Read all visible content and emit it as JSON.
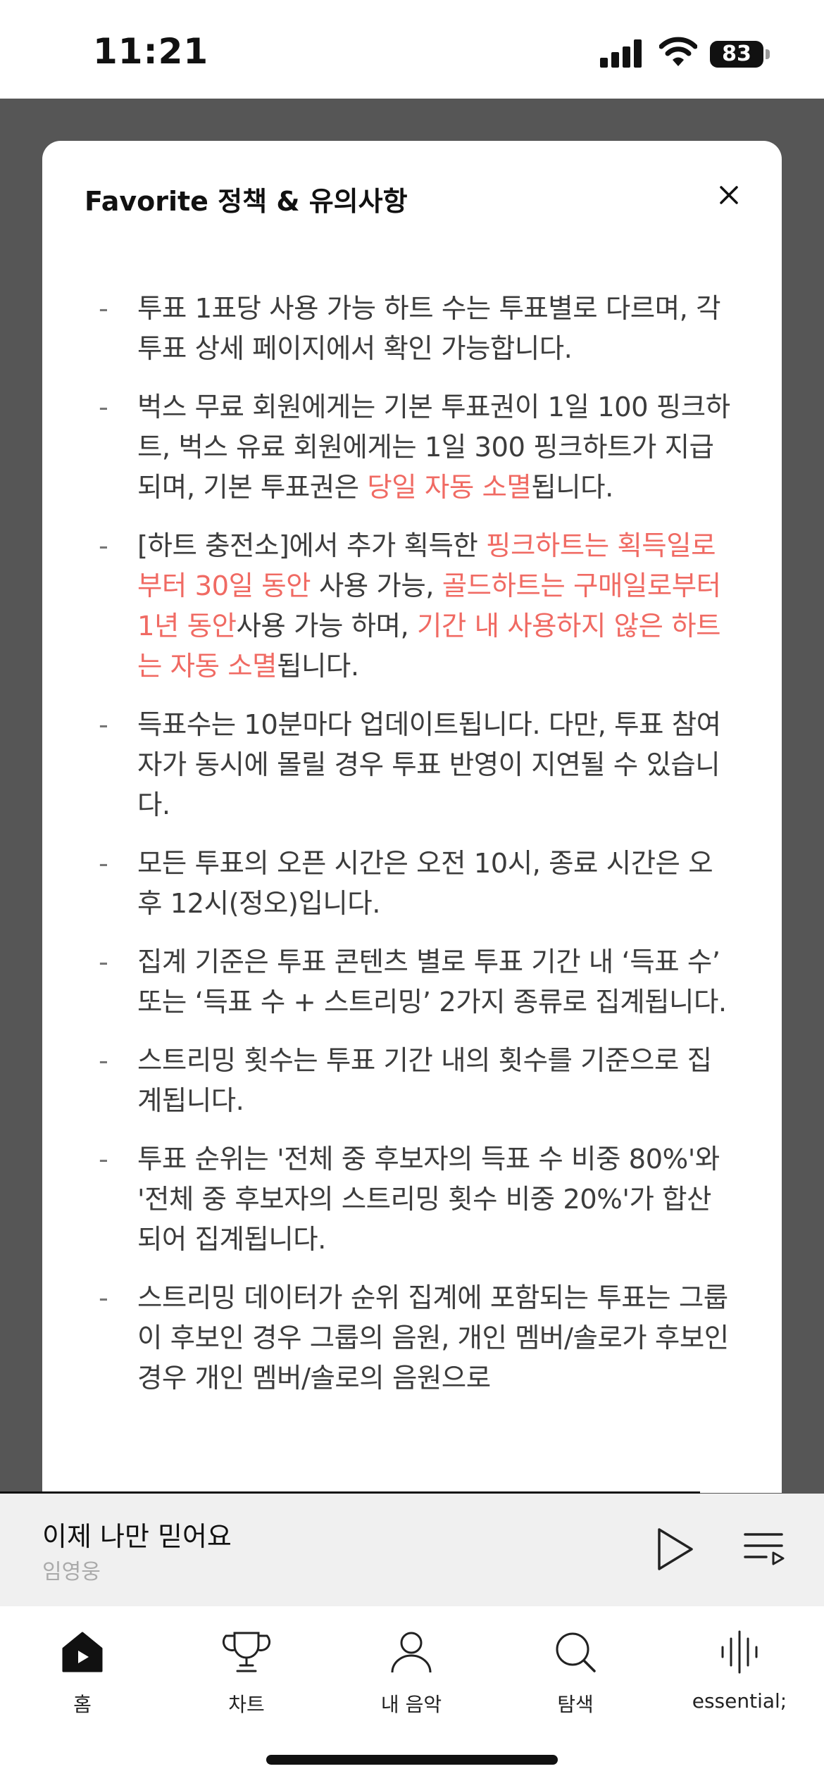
{
  "status_bar": {
    "time": "11:21",
    "battery": "83"
  },
  "sheet": {
    "title": "Favorite 정책 & 유의사항",
    "accent_color": "#f06a63",
    "items": [
      {
        "parts": [
          {
            "text": "투표 1표당 사용 가능 하트 수는 투표별로 다르며, 각 투표 상세 페이지에서 확인 가능합니다."
          }
        ]
      },
      {
        "parts": [
          {
            "text": "벅스 무료 회원에게는 기본 투표권이 1일 100 핑크하트, 벅스 유료 회원에게는 1일 300 핑크하트가 지급되며, 기본 투표권은 "
          },
          {
            "text": "당일 자동 소멸",
            "hl": true
          },
          {
            "text": "됩니다."
          }
        ]
      },
      {
        "parts": [
          {
            "text": "[하트 충전소]에서 추가 획득한 "
          },
          {
            "text": "핑크하트는 획득일로부터 30일 동안",
            "hl": true
          },
          {
            "text": " 사용 가능, "
          },
          {
            "text": "골드하트는 구매일로부터 1년 동안",
            "hl": true
          },
          {
            "text": "사용 가능 하며, "
          },
          {
            "text": "기간 내 사용하지 않은 하트는 자동 소멸",
            "hl": true
          },
          {
            "text": "됩니다."
          }
        ]
      },
      {
        "parts": [
          {
            "text": "득표수는 10분마다 업데이트됩니다. 다만, 투표 참여자가 동시에 몰릴 경우 투표 반영이 지연될 수 있습니다."
          }
        ]
      },
      {
        "parts": [
          {
            "text": "모든 투표의 오픈 시간은 오전 10시, 종료 시간은 오후 12시(정오)입니다."
          }
        ]
      },
      {
        "parts": [
          {
            "text": "집계 기준은 투표 콘텐츠 별로 투표 기간 내 ‘득표 수’ 또는 ‘득표 수 + 스트리밍’ 2가지 종류로 집계됩니다."
          }
        ]
      },
      {
        "parts": [
          {
            "text": "스트리밍 횟수는 투표 기간 내의 횟수를 기준으로 집계됩니다."
          }
        ]
      },
      {
        "parts": [
          {
            "text": "투표 순위는 '전체 중 후보자의 득표 수 비중 80%'와 '전체 중 후보자의 스트리밍 횟수 비중 20%'가 합산되어 집계됩니다."
          }
        ]
      },
      {
        "parts": [
          {
            "text": "스트리밍 데이터가 순위 집계에 포함되는 투표는 그룹이 후보인 경우 그룹의 음원, 개인 멤버/솔로가 후보인 경우 개인 멤버/솔로의 음원으로"
          }
        ]
      }
    ]
  },
  "player": {
    "title": "이제 나만 믿어요",
    "artist": "임영웅"
  },
  "tabs": [
    {
      "label": "홈",
      "icon": "home-icon"
    },
    {
      "label": "차트",
      "icon": "trophy-icon"
    },
    {
      "label": "내 음악",
      "icon": "person-icon"
    },
    {
      "label": "탐색",
      "icon": "search-icon"
    },
    {
      "label": "essential;",
      "icon": "waveform-icon"
    }
  ]
}
